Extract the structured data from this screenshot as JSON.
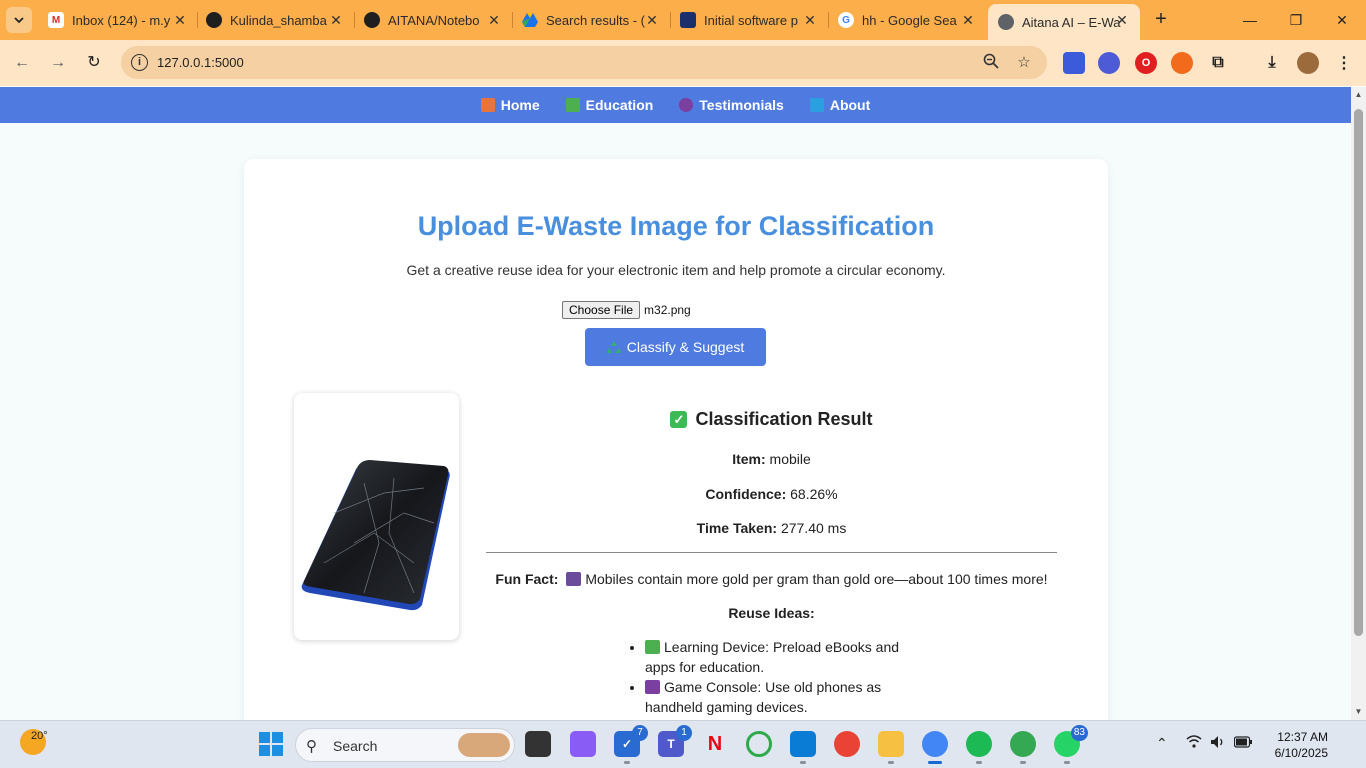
{
  "browser": {
    "tabs": [
      {
        "title": "Inbox (124) - m.y",
        "icon": "gmail-icon",
        "color": "#d93025"
      },
      {
        "title": "Kulinda_shamba",
        "icon": "github-icon",
        "color": "#1f1f1f"
      },
      {
        "title": "AITANA/Notebo",
        "icon": "github-icon",
        "color": "#1f1f1f"
      },
      {
        "title": "Search results - (",
        "icon": "google-drive-icon",
        "color": "#1a73e8"
      },
      {
        "title": "Initial software p",
        "icon": "document-icon",
        "color": "#1a2f6b"
      },
      {
        "title": "hh - Google Sea",
        "icon": "google-icon",
        "color": "#4285f4"
      },
      {
        "title": "Aitana AI – E-Wa",
        "icon": "globe-icon",
        "color": "#5f6368",
        "active": true
      }
    ],
    "url": "127.0.0.1:5000"
  },
  "nav": {
    "items": [
      {
        "label": "Home",
        "icon": "house-icon",
        "color": "#e8743b"
      },
      {
        "label": "Education",
        "icon": "books-icon",
        "color": "#4caf50"
      },
      {
        "label": "Testimonials",
        "icon": "speech-icon",
        "color": "#7b3fa0"
      },
      {
        "label": "About",
        "icon": "book-icon",
        "color": "#2aa0e0"
      }
    ]
  },
  "upload": {
    "title": "Upload E-Waste Image for Classification",
    "subtitle": "Get a creative reuse idea for your electronic item and help promote a circular economy.",
    "choose_file_label": "Choose File",
    "file_name": "m32.png",
    "classify_label": "Classify & Suggest"
  },
  "result": {
    "heading": "Classification Result",
    "item_label": "Item:",
    "item_value": "mobile",
    "confidence_label": "Confidence:",
    "confidence_value": "68.26%",
    "time_label": "Time Taken:",
    "time_value": "277.40 ms",
    "fun_fact_label": "Fun Fact:",
    "fun_fact_text": "Mobiles contain more gold per gram than gold ore—about 100 times more!",
    "reuse_label": "Reuse Ideas:",
    "reuse_ideas": [
      "Learning Device: Preload eBooks and apps for education.",
      "Game Console: Use old phones as handheld gaming devices."
    ]
  },
  "taskbar": {
    "temperature": "20°",
    "search_label": "Search",
    "badge_todo": "7",
    "badge_teams": "1",
    "badge_whatsapp": "83",
    "time": "12:37 AM",
    "date": "6/10/2025"
  }
}
